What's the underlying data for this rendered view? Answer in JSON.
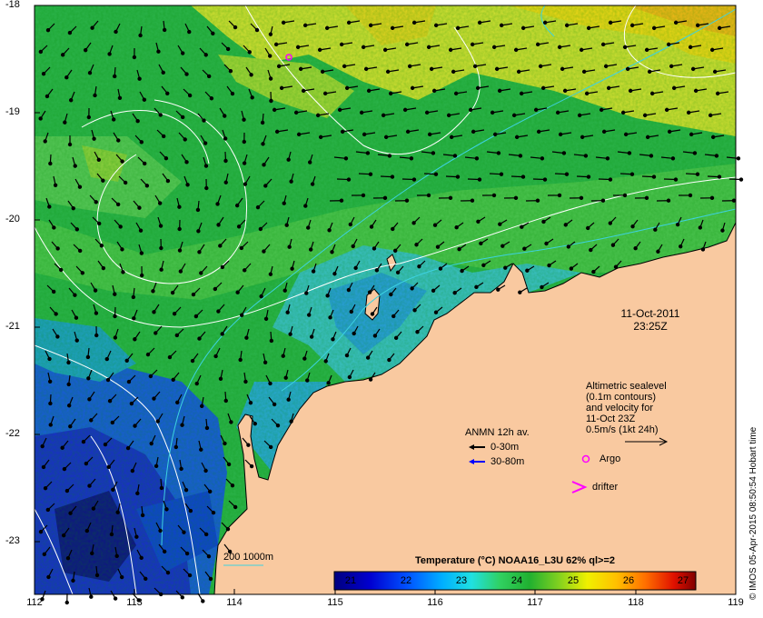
{
  "map": {
    "lon_ticks": [
      "112",
      "113",
      "114",
      "115",
      "116",
      "117",
      "118",
      "119"
    ],
    "lat_ticks": [
      "-18",
      "-19",
      "-20",
      "-21",
      "-22",
      "-23"
    ],
    "land_color": "#f9c9a0",
    "contour_color": "#ffffff",
    "isobath_color": "#3dd2e0"
  },
  "date_label": {
    "date": "11-Oct-2011",
    "time": "23:25Z"
  },
  "altimetry": {
    "lines": [
      "Altimetric sealevel",
      "(0.1m contours)",
      "and velocity for",
      "11-Oct 23Z",
      "0.5m/s (1kt 24h)"
    ]
  },
  "anmn": {
    "title": "ANMN 12h av.",
    "items": [
      {
        "label": "0-30m",
        "color": "#000000"
      },
      {
        "label": "30-80m",
        "color": "#0000ff"
      }
    ]
  },
  "markers": {
    "argo_label": "Argo",
    "argo_color": "#ff00ff",
    "drifter_label": "drifter",
    "drifter_color": "#ff00ff"
  },
  "contour_legend": {
    "label": "200  1000m"
  },
  "colorbar": {
    "title": "Temperature (°C) NOAA16_L3U 62% ql>=2",
    "ticks": [
      "21",
      "22",
      "23",
      "24",
      "25",
      "26",
      "27"
    ],
    "range": [
      20.75,
      27.25
    ],
    "colors": [
      "#00007f",
      "#0000d0",
      "#0040ff",
      "#0090ff",
      "#00d8ff",
      "#30f0c0",
      "#20c050",
      "#10b030",
      "#80d020",
      "#e0e000",
      "#ffc000",
      "#ff8000",
      "#ff3000",
      "#c00000",
      "#7f0000"
    ]
  },
  "credit": "© IMOS 05-Apr-2015 08:50:54 Hobart time"
}
